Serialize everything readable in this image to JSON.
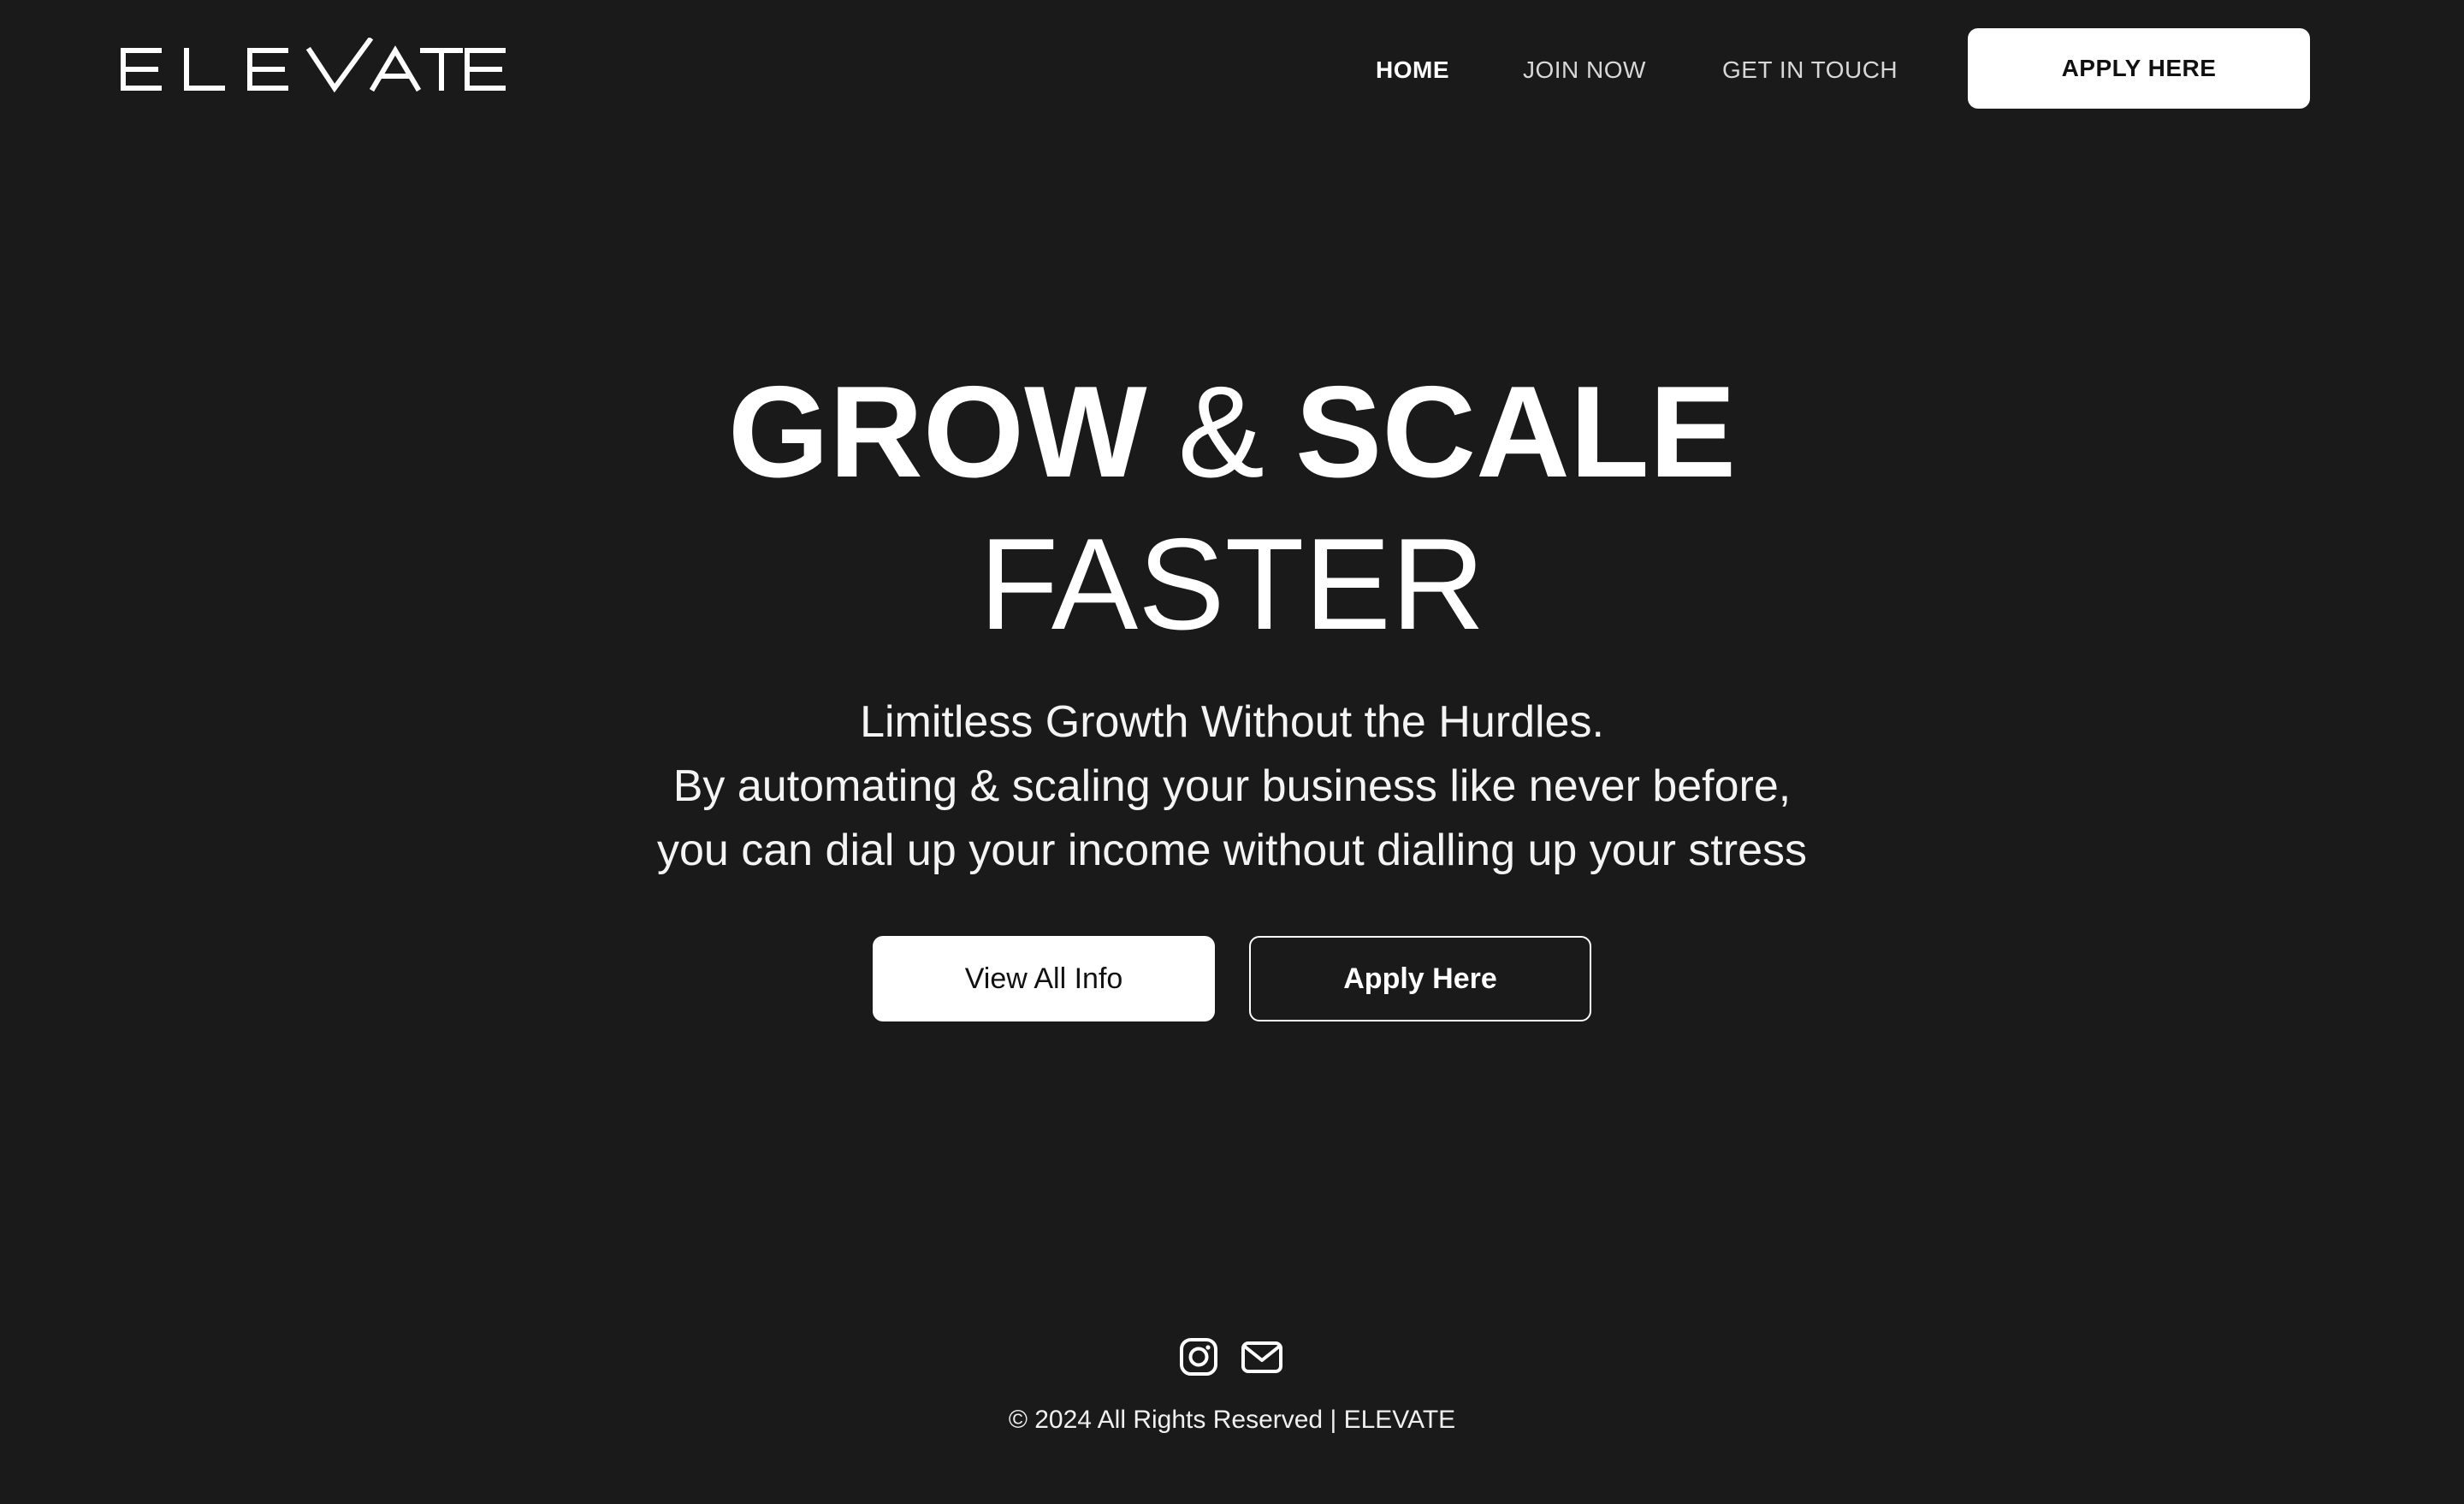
{
  "brand": {
    "logo_text": "ELEVATE"
  },
  "nav": {
    "items": [
      {
        "label": "HOME",
        "active": true
      },
      {
        "label": "JOIN NOW",
        "active": false
      },
      {
        "label": "GET IN TOUCH",
        "active": false
      }
    ],
    "cta_label": "APPLY HERE"
  },
  "hero": {
    "title_word1": "GROW",
    "title_amp": "&",
    "title_word2": "SCALE",
    "title_line2": "FASTER",
    "subtitle_lines": [
      "Limitless Growth Without the Hurdles.",
      "By automating & scaling your business like never before,",
      "you can dial up your income without dialling up your stress"
    ],
    "primary_button": "View All Info",
    "secondary_button": "Apply Here"
  },
  "footer": {
    "social_icons": [
      "instagram-icon",
      "mail-icon"
    ],
    "copyright": "© 2024 All Rights Reserved | ELEVATE"
  },
  "colors": {
    "background": "#1a1a1a",
    "text": "#ffffff",
    "button_fill": "#ffffff",
    "button_text": "#111111"
  }
}
